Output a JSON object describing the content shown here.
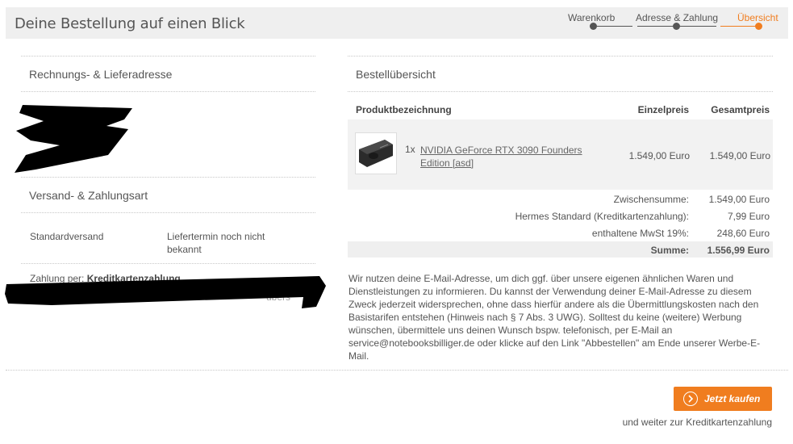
{
  "header": {
    "title": "Deine Bestellung auf einen Blick",
    "steps": [
      {
        "label": "Warenkorb",
        "state": "done"
      },
      {
        "label": "Adresse & Zahlung",
        "state": "done"
      },
      {
        "label": "Übersicht",
        "state": "active"
      }
    ]
  },
  "left": {
    "address_title": "Rechnungs- & Lieferadresse",
    "shipping_title": "Versand- & Zahlungsart",
    "shipping_method": "Standardversand",
    "delivery_date": "Liefertermin noch nicht bekannt",
    "payment_label": "Zahlung per:",
    "payment_method": "Kreditkartenzahlung",
    "payment_extra_fragment": "ubers"
  },
  "order": {
    "title": "Bestellübersicht",
    "columns": {
      "product": "Produktbezeichnung",
      "unit_price": "Einzelpreis",
      "total_price": "Gesamtpreis"
    },
    "items": [
      {
        "qty": "1x",
        "name": "NVIDIA GeForce RTX 3090 Founders Edition",
        "variant": "[asd]",
        "unit_price": "1.549,00 Euro",
        "total_price": "1.549,00 Euro"
      }
    ],
    "summary": [
      {
        "label": "Zwischensumme:",
        "value": "1.549,00 Euro"
      },
      {
        "label": "Hermes Standard (Kreditkartenzahlung):",
        "value": "7,99 Euro"
      },
      {
        "label": "enthaltene MwSt 19%:",
        "value": "248,60 Euro"
      }
    ],
    "total": {
      "label": "Summe:",
      "value": "1.556,99 Euro"
    }
  },
  "notice": "Wir nutzen deine E-Mail-Adresse, um dich ggf. über unsere eigenen ähnlichen Waren und Dienstleistungen zu informieren. Du kannst der Verwendung deiner E-Mail-Adresse zu diesem Zweck jederzeit widersprechen, ohne dass hierfür andere als die Übermittlungskosten nach den Basistarifen entstehen (Hinweis nach § 7 Abs. 3 UWG). Solltest du keine (weitere) Werbung wünschen, übermittele uns deinen Wunsch bspw. telefonisch, per E-Mail an service@notebooksbilliger.de oder klicke auf den Link \"Abbestellen\" am Ende unserer Werbe-E-Mail.",
  "actions": {
    "buy_label": "Jetzt kaufen",
    "buy_icon": "chevron-right-circle-icon",
    "buy_subtext": "und weiter zur Kreditkartenzahlung"
  },
  "colors": {
    "accent": "#f07d1f",
    "header_bg": "#efefef",
    "row_bg": "#f2f2f2",
    "redaction": "#000000"
  }
}
